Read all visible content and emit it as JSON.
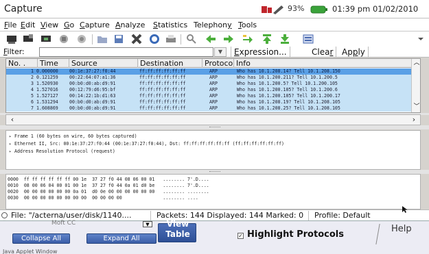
{
  "window": {
    "title": "Capture",
    "battery_percent": "93%",
    "clock": "01:39 pm 01/02/2010"
  },
  "menubar": {
    "items": [
      {
        "pre": "",
        "u": "F",
        "post": "ile"
      },
      {
        "pre": "",
        "u": "E",
        "post": "dit"
      },
      {
        "pre": "",
        "u": "V",
        "post": "iew"
      },
      {
        "pre": "",
        "u": "G",
        "post": "o"
      },
      {
        "pre": "",
        "u": "C",
        "post": "apture"
      },
      {
        "pre": "",
        "u": "A",
        "post": "nalyze"
      },
      {
        "pre": "",
        "u": "S",
        "post": "tatistics"
      },
      {
        "pre": "Telephon",
        "u": "y",
        "post": ""
      },
      {
        "pre": "",
        "u": "T",
        "post": "ools"
      }
    ]
  },
  "filter": {
    "label_u": "F",
    "label_post": "ilter:",
    "value": "",
    "expression_pre": "E",
    "expression_post": "xpression...",
    "clear_pre": "Clea",
    "clear_u": "r",
    "clear_post": "",
    "apply_pre": "Ap",
    "apply_u": "p",
    "apply_post": "ly"
  },
  "packet_list": {
    "columns": [
      "No. .",
      "Time",
      "Source",
      "Destination",
      "Protocol",
      "Info"
    ],
    "rows": [
      [
        "1",
        "0.000000",
        "00:1e:37:27:f0:44",
        "ff:ff:ff:ff:ff:ff",
        "ARP",
        "Who has 10.1.208.14?  Tell 10.1.208.150"
      ],
      [
        "2",
        "0.121259",
        "00:22:64:07:a1:36",
        "ff:ff:ff:ff:ff:ff",
        "ARP",
        "Who has 10.1.200.211?  Tell 10.1.200.5"
      ],
      [
        "3",
        "1.520930",
        "00:b0:d0:ab:d9:91",
        "ff:ff:ff:ff:ff:ff",
        "ARP",
        "Who has 10.1.200.5?  Tell 10.1.200.105"
      ],
      [
        "4",
        "1.527016",
        "00:12:79:d6:95:bf",
        "ff:ff:ff:ff:ff:ff",
        "ARP",
        "Who has 10.1.200.105?  Tell 10.1.200.6"
      ],
      [
        "5",
        "1.527127",
        "00:14:22:1b:d1:63",
        "ff:ff:ff:ff:ff:ff",
        "ARP",
        "Who has 10.1.200.105?  Tell 10.1.200.17"
      ],
      [
        "6",
        "1.531294",
        "00:b0:d0:ab:d9:91",
        "ff:ff:ff:ff:ff:ff",
        "ARP",
        "Who has 10.1.208.19?  Tell 10.1.208.105"
      ],
      [
        "7",
        "1.608869",
        "00:b0:d0:ab:d9:91",
        "ff:ff:ff:ff:ff:ff",
        "ARP",
        "Who has 10.1.208.25?  Tell 10.1.208.105"
      ]
    ]
  },
  "details": {
    "rows": [
      "Frame 1 (60 bytes on wire, 60 bytes captured)",
      "Ethernet II, Src: 00:1e:37:27:f0:44 (00:1e:37:27:f0:44), Dst: ff:ff:ff:ff:ff:ff (ff:ff:ff:ff:ff:ff)",
      "Address Resolution Protocol (request)"
    ]
  },
  "bytes": {
    "rows": [
      "0000  ff ff ff ff ff ff 00 1e  37 27 f0 44 08 06 00 01   ........ 7'.D....",
      "0010  08 00 06 04 00 01 00 1e  37 27 f0 44 0a 01 d0 be   ........ 7'.D....",
      "0020  00 00 00 00 00 00 0a 01  d0 0e 00 00 00 00 00 00   ........ ........",
      "0030  00 00 00 00 00 00 00 00  00 00 00 00               ........ ...."
    ]
  },
  "status": {
    "file": "File: \"/acterna/user/disk/1140....",
    "packets": "Packets: 144 Displayed: 144 Marked: 0",
    "profile": "Profile: Default"
  },
  "applet": {
    "partial_text": "Moft CC",
    "collapse_all": "Collapse All",
    "expand_all": "Expand All",
    "view_table_line1": "View",
    "view_table_line2": "Table",
    "highlight_check": "✓",
    "highlight_protocols": "Highlight Protocols",
    "help": "Help",
    "caption": "Java Applet Window"
  }
}
